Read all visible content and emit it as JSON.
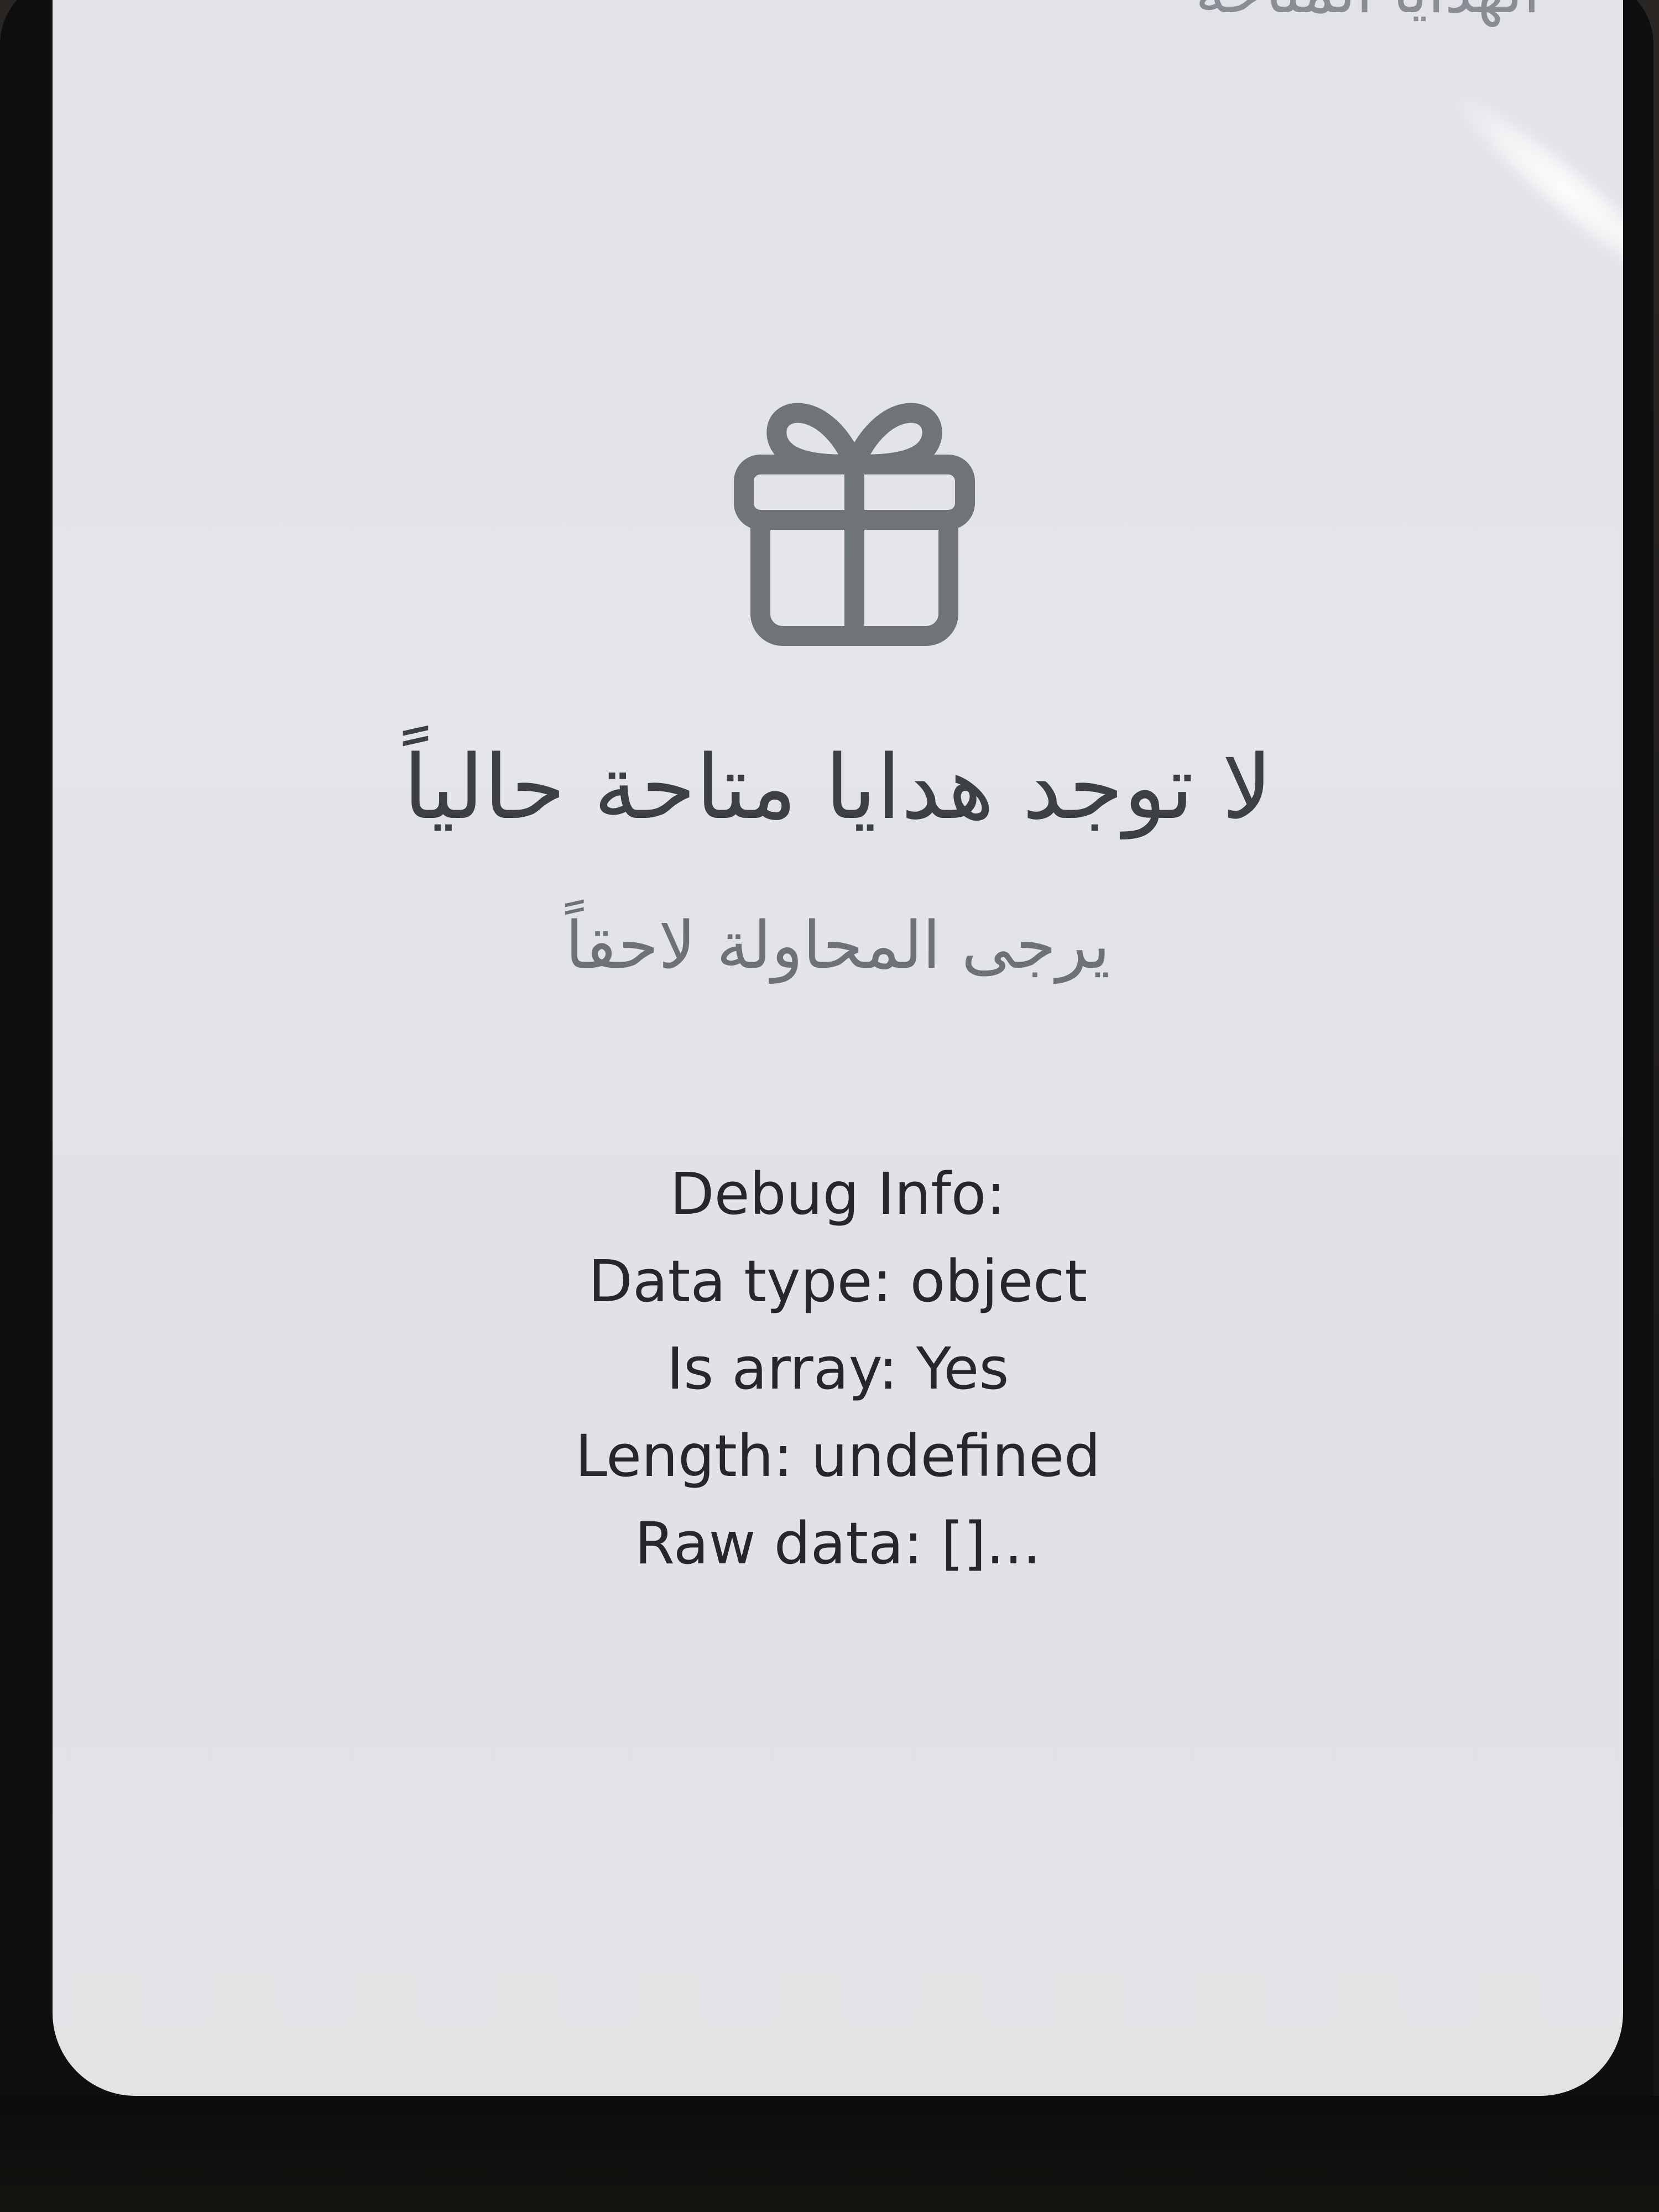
{
  "header": {
    "title": "الهدايا المتاحة"
  },
  "empty_state": {
    "icon": "gift-icon",
    "icon_color": "#6f7479",
    "title": "لا توجد هدايا متاحة حالياً",
    "subtitle": "يرجى المحاولة لاحقاً"
  },
  "debug": {
    "heading": "Debug Info:",
    "data_type": "Data type: object",
    "is_array": "Is array: Yes",
    "length": "Length: undefined",
    "raw_data": "Raw data: []..."
  }
}
